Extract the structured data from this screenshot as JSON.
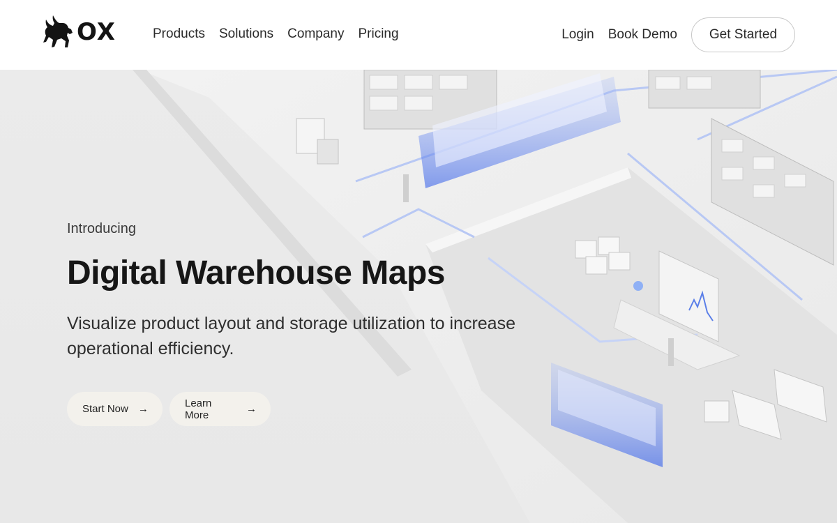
{
  "brand": {
    "name": "OX",
    "logo_icon": "bull-icon"
  },
  "nav": {
    "products": "Products",
    "solutions": "Solutions",
    "company": "Company",
    "pricing": "Pricing"
  },
  "right_nav": {
    "login": "Login",
    "book_demo": "Book Demo",
    "get_started": "Get Started"
  },
  "hero": {
    "eyebrow": "Introducing",
    "title": "Digital Warehouse Maps",
    "subtitle": "Visualize product layout and storage utilization to increase operational efficiency.",
    "start_now": "Start Now",
    "learn_more": "Learn More",
    "arrow_icon": "arrow-right-icon"
  },
  "colors": {
    "accent_blue": "#5b7fe8",
    "header_bg": "#ffffff",
    "hero_bg": "#ebebeb",
    "button_bg": "#f3f1ec"
  }
}
